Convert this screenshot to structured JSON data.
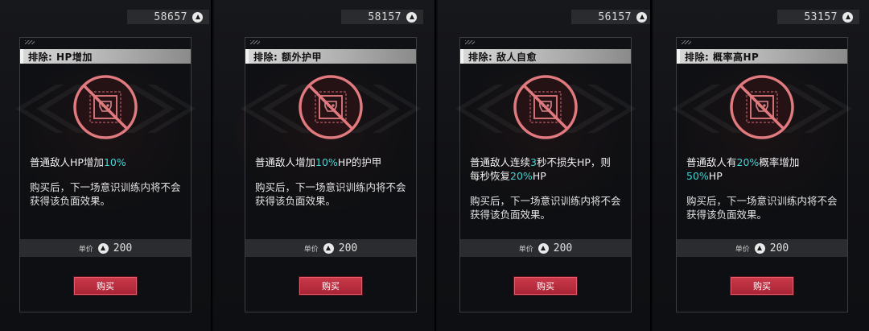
{
  "buy_label": "购买",
  "price_label": "单价",
  "price_value": "200",
  "note": "购买后，下一场意识训练内将不会\n获得该负面效果。",
  "accent_color": "#3fd4d4",
  "button_color": "#c9394a",
  "cards": [
    {
      "currency": "58657",
      "title": "排除: HP增加",
      "effect_parts": [
        {
          "text": "普通敌人HP增加",
          "hl": false
        },
        {
          "text": "10%",
          "hl": true
        }
      ],
      "effect_lines": 1
    },
    {
      "currency": "58157",
      "title": "排除: 额外护甲",
      "effect_parts": [
        {
          "text": "普通敌人增加",
          "hl": false
        },
        {
          "text": "10%",
          "hl": true
        },
        {
          "text": "HP的护甲",
          "hl": false
        }
      ],
      "effect_lines": 1
    },
    {
      "currency": "56157",
      "title": "排除: 敌人自愈",
      "effect_parts": [
        {
          "text": "普通敌人连续",
          "hl": false
        },
        {
          "text": "3",
          "hl": true
        },
        {
          "text": "秒不损失HP，则\n每秒恢复",
          "hl": false
        },
        {
          "text": "20%",
          "hl": true
        },
        {
          "text": "HP",
          "hl": false
        }
      ],
      "effect_lines": 2
    },
    {
      "currency": "53157",
      "title": "排除: 概率高HP",
      "effect_parts": [
        {
          "text": "普通敌人有",
          "hl": false
        },
        {
          "text": "20%",
          "hl": true
        },
        {
          "text": "概率增加\n",
          "hl": false
        },
        {
          "text": "50%",
          "hl": true
        },
        {
          "text": "HP",
          "hl": false
        }
      ],
      "effect_lines": 2
    }
  ]
}
